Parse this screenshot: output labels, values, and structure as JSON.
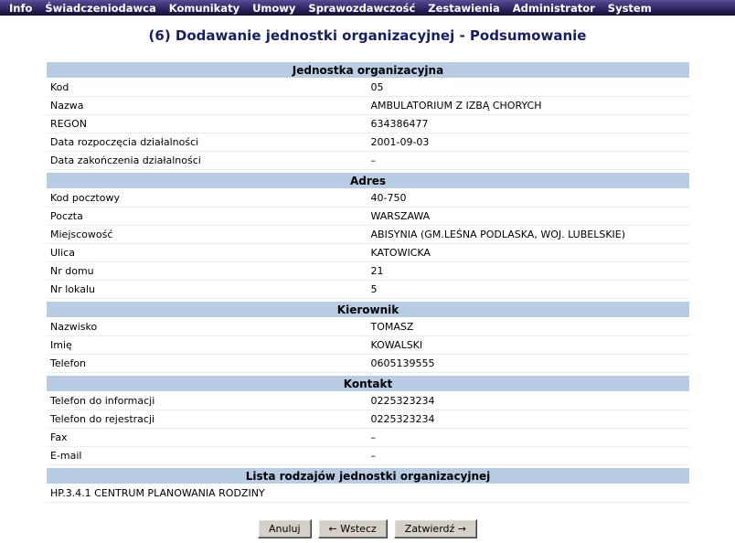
{
  "menubar": {
    "items": [
      {
        "label": "Info"
      },
      {
        "label": "Świadczeniodawca"
      },
      {
        "label": "Komunikaty"
      },
      {
        "label": "Umowy"
      },
      {
        "label": "Sprawozdawczość"
      },
      {
        "label": "Zestawienia"
      },
      {
        "label": "Administrator"
      },
      {
        "label": "System"
      }
    ]
  },
  "page": {
    "title": "(6) Dodawanie jednostki organizacyjnej - Podsumowanie"
  },
  "sections": [
    {
      "header": "Jednostka organizacyjna",
      "label_width": 207,
      "rows": [
        {
          "label": "Kod",
          "value": "05"
        },
        {
          "label": "Nazwa",
          "value": "AMBULATORIUM Z IZBĄ CHORYCH"
        },
        {
          "label": "REGON",
          "value": "634386477"
        },
        {
          "label": "Data rozpoczęcia działalności",
          "value": "2001-09-03"
        },
        {
          "label": "Data zakończenia działalności",
          "value": "–"
        }
      ]
    },
    {
      "header": "Adres",
      "label_width": 145,
      "rows": [
        {
          "label": "Kod pocztowy",
          "value": "40-750"
        },
        {
          "label": "Poczta",
          "value": "WARSZAWA"
        },
        {
          "label": "Miejscowość",
          "value": "ABISYNIA (GM.LEŚNA PODLASKA, WOJ. LUBELSKIE)"
        },
        {
          "label": "Ulica",
          "value": "KATOWICKA"
        },
        {
          "label": "Nr domu",
          "value": "21"
        },
        {
          "label": "Nr lokalu",
          "value": "5"
        }
      ]
    },
    {
      "header": "Kierownik",
      "label_width": 145,
      "rows": [
        {
          "label": "Nazwisko",
          "value": "TOMASZ"
        },
        {
          "label": "Imię",
          "value": "KOWALSKI"
        },
        {
          "label": "Telefon",
          "value": "0605139555"
        }
      ]
    },
    {
      "header": "Kontakt",
      "label_width": 145,
      "rows": [
        {
          "label": "Telefon do informacji",
          "value": "0225323234"
        },
        {
          "label": "Telefon do rejestracji",
          "value": "0225323234"
        },
        {
          "label": "Fax",
          "value": "–"
        },
        {
          "label": "E-mail",
          "value": "–"
        }
      ]
    }
  ],
  "list_section": {
    "header": "Lista rodzajów jednostki organizacyjnej",
    "items": [
      "HP.3.4.1 CENTRUM PLANOWANIA RODZINY"
    ]
  },
  "buttons": [
    {
      "name": "cancel-button",
      "label": "Anuluj"
    },
    {
      "name": "back-button",
      "label": "← Wstecz"
    },
    {
      "name": "confirm-button",
      "label": "Zatwierdź →"
    }
  ],
  "colors": {
    "menubar_top": "#5b4f96",
    "menubar_bottom": "#15103a",
    "section_header_bg": "#b8cce4",
    "title_text": "#1b1b66",
    "row_border": "#e9edf2",
    "button_face": "#d4d0c8"
  }
}
